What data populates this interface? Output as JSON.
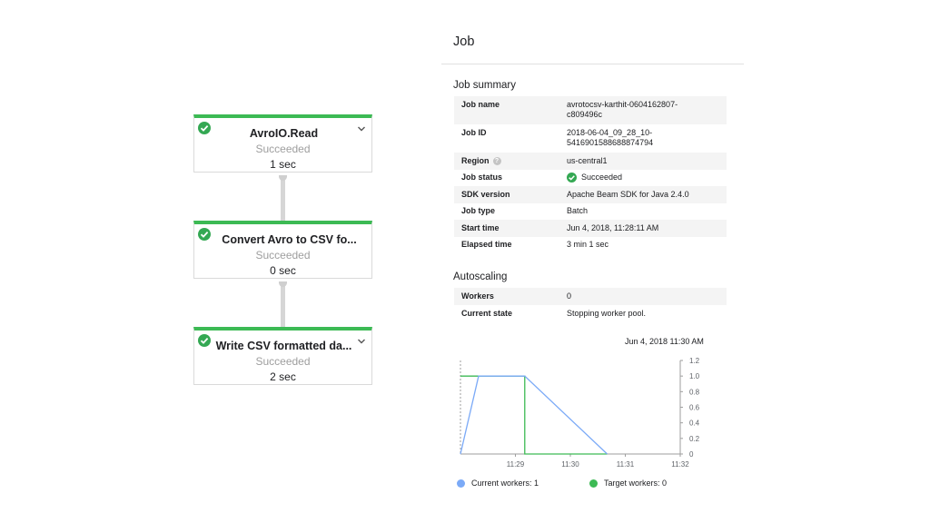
{
  "pipeline": {
    "steps": [
      {
        "name": "AvroIO.Read",
        "status": "Succeeded",
        "duration": "1 sec"
      },
      {
        "name": "Convert Avro to CSV fo...",
        "status": "Succeeded",
        "duration": "0 sec"
      },
      {
        "name": "Write CSV formatted da...",
        "status": "Succeeded",
        "duration": "2 sec"
      }
    ]
  },
  "panel": {
    "title": "Job",
    "summary_title": "Job summary",
    "summary": {
      "job_name": {
        "label": "Job name",
        "value_line1": "avrotocsv-karthit-0604162807-",
        "value_line2": "c809496c"
      },
      "job_id": {
        "label": "Job ID",
        "value_line1": "2018-06-04_09_28_10-",
        "value_line2": "5416901588688874794"
      },
      "region": {
        "label": "Region",
        "value": "us-central1"
      },
      "job_status": {
        "label": "Job status",
        "value": "Succeeded"
      },
      "sdk_version": {
        "label": "SDK version",
        "value": "Apache Beam SDK for Java 2.4.0"
      },
      "job_type": {
        "label": "Job type",
        "value": "Batch"
      },
      "start_time": {
        "label": "Start time",
        "value": "Jun 4, 2018, 11:28:11 AM"
      },
      "elapsed_time": {
        "label": "Elapsed time",
        "value": "3 min 1 sec"
      }
    },
    "autoscaling_title": "Autoscaling",
    "autoscaling": {
      "workers": {
        "label": "Workers",
        "value": "0"
      },
      "current_state": {
        "label": "Current state",
        "value": "Stopping worker pool."
      }
    },
    "chart_timestamp": "Jun 4, 2018 11:30 AM"
  },
  "colors": {
    "success": "#34a853",
    "current_workers": "#7baaf7",
    "target_workers": "#3cba54"
  },
  "icons": {
    "step_status": "check-circle-icon",
    "step_menu": "chevron-down-icon",
    "region_help": "help-icon"
  },
  "chart_data": {
    "type": "line",
    "x_ticks": [
      "11:29",
      "11:30",
      "11:31",
      "11:32"
    ],
    "y_ticks": [
      "0",
      "0.2",
      "0.4",
      "0.6",
      "0.8",
      "1.0",
      "1.2"
    ],
    "xlim_minutes": [
      28.0,
      32.0
    ],
    "ylim": [
      0,
      1.2
    ],
    "series": [
      {
        "name": "Current workers: 1",
        "color": "#7baaf7",
        "x_minutes": [
          28.0,
          28.33,
          29.17,
          30.67
        ],
        "y": [
          0,
          1,
          1,
          0
        ]
      },
      {
        "name": "Target workers: 0",
        "color": "#3cba54",
        "x_minutes": [
          28.0,
          29.17,
          29.17,
          30.67
        ],
        "y": [
          1,
          1,
          0,
          0
        ]
      }
    ],
    "grid": false,
    "legend_position": "bottom"
  }
}
